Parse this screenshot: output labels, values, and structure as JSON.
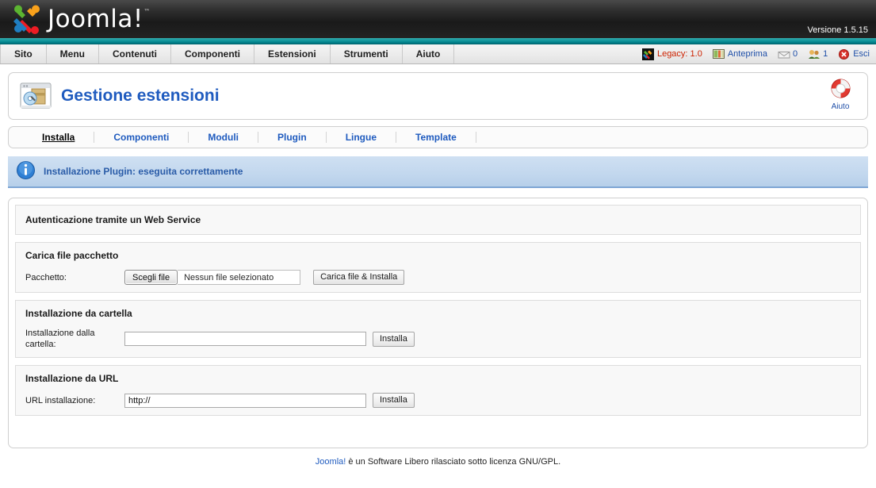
{
  "header": {
    "logo_text": "Joomla!",
    "logo_tm": "™",
    "version": "Versione 1.5.15"
  },
  "menu": {
    "items": [
      {
        "label": "Sito",
        "name": "sito"
      },
      {
        "label": "Menu",
        "name": "menu"
      },
      {
        "label": "Contenuti",
        "name": "contenuti"
      },
      {
        "label": "Componenti",
        "name": "componenti"
      },
      {
        "label": "Estensioni",
        "name": "estensioni"
      },
      {
        "label": "Strumenti",
        "name": "strumenti"
      },
      {
        "label": "Aiuto",
        "name": "aiuto"
      }
    ],
    "status": {
      "legacy": "Legacy: 1.0",
      "preview": "Anteprima",
      "messages_count": "0",
      "users_count": "1",
      "logout": "Esci"
    }
  },
  "title": {
    "text": "Gestione estensioni",
    "help_label": "Aiuto"
  },
  "tabs": [
    {
      "label": "Installa",
      "active": true
    },
    {
      "label": "Componenti",
      "active": false
    },
    {
      "label": "Moduli",
      "active": false
    },
    {
      "label": "Plugin",
      "active": false
    },
    {
      "label": "Lingue",
      "active": false
    },
    {
      "label": "Template",
      "active": false
    }
  ],
  "message": {
    "text": "Installazione Plugin: eseguita correttamente"
  },
  "content": {
    "service_legend": "Autenticazione tramite un Web Service",
    "upload": {
      "legend": "Carica file pacchetto",
      "label": "Pacchetto:",
      "choose_button": "Scegli file",
      "file_status": "Nessun file selezionato",
      "submit_button": "Carica file & Installa"
    },
    "folder": {
      "legend": "Installazione da cartella",
      "label": "Installazione dalla cartella:",
      "value": "",
      "submit_button": "Installa"
    },
    "url": {
      "legend": "Installazione da URL",
      "label": "URL installazione:",
      "value": "http://",
      "submit_button": "Installa"
    }
  },
  "footer": {
    "link": "Joomla!",
    "text": " è un Software Libero rilasciato sotto licenza GNU/GPL."
  },
  "colors": {
    "accent_teal": "#009aa0",
    "link_blue": "#1f5bbf",
    "legacy_red": "#cc2200",
    "message_blue": "#2a5ca8"
  }
}
